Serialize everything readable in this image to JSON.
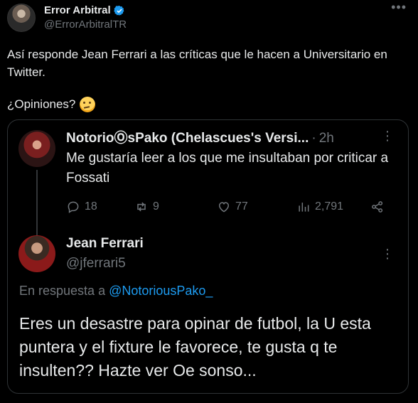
{
  "tweet": {
    "author": {
      "name": "Error Arbitral",
      "handle": "@ErrorArbitralTR",
      "verified": true
    },
    "text": "Así responde Jean Ferrari a las críticas que le hacen a Universitario en Twitter.",
    "question": "¿Opiniones?",
    "emoji": "thinking-face"
  },
  "quoted": {
    "first": {
      "name": "NotorioⓄsPako (Chelascues's Versi...",
      "time": "2h",
      "text": "Me gustaría leer a los que me insultaban por criticar a Fossati",
      "replies": "18",
      "retweets": "9",
      "likes": "77",
      "views": "2,791"
    },
    "reply": {
      "name": "Jean Ferrari",
      "handle": "@jferrari5",
      "reply_prefix": "En respuesta a",
      "reply_handle": "@NotoriousPako_",
      "text": "Eres un desastre para opinar de futbol, la U esta puntera y el fixture le favorece, te gusta q te insulten?? Hazte ver Oe sonso..."
    }
  },
  "colors": {
    "background": "#000000",
    "text": "#e7e9ea",
    "muted": "#71767b",
    "accent": "#1d9bf0",
    "border": "#2f3336"
  }
}
